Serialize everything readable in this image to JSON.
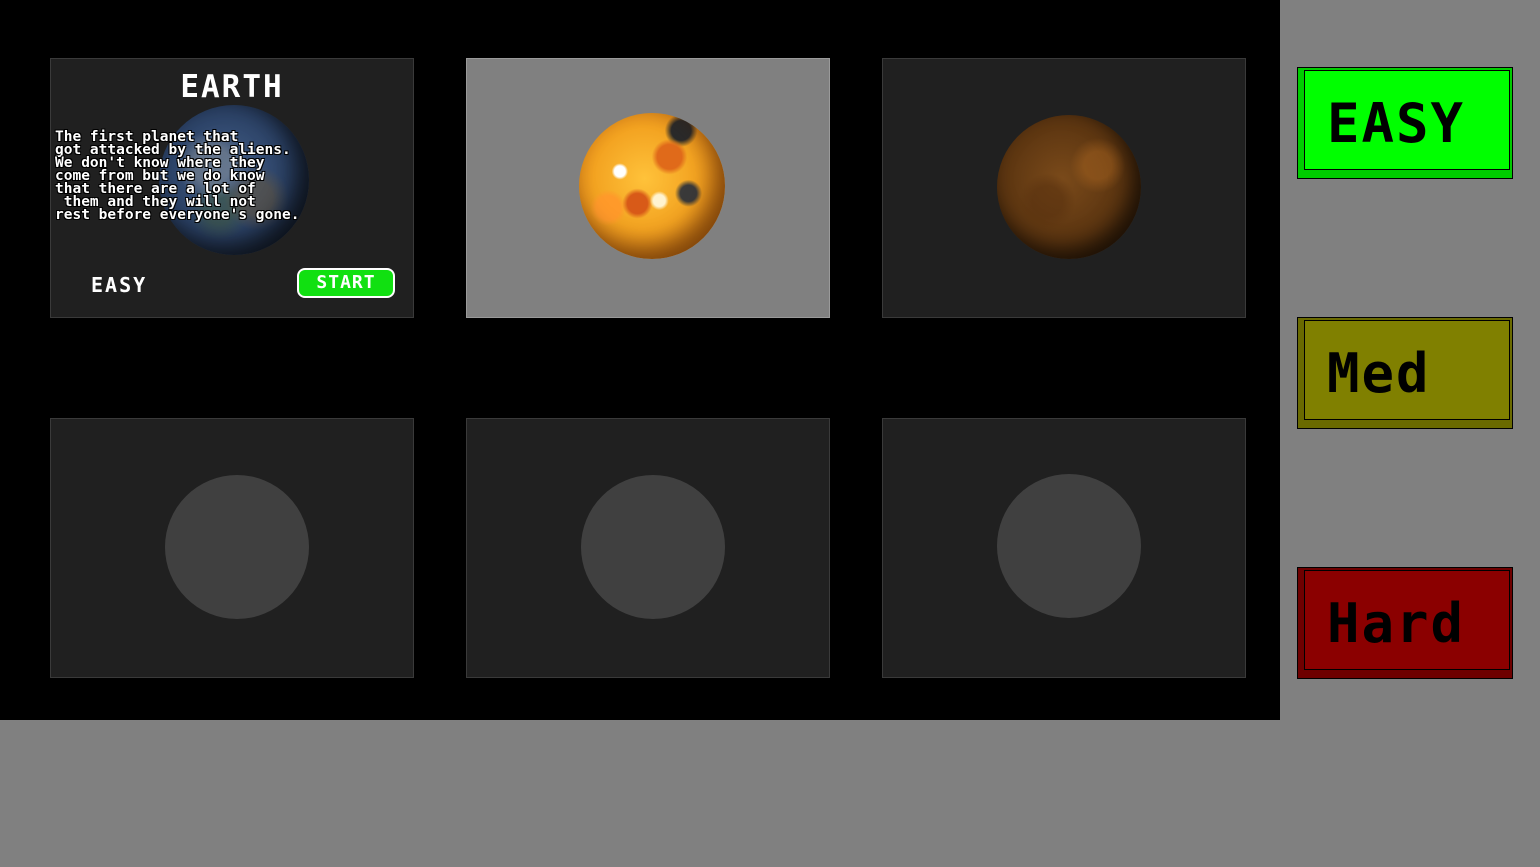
{
  "level_select": {
    "cards": [
      {
        "title": "EARTH",
        "description_lines": [
          "The first planet that",
          "got attacked by the aliens.",
          "We don't know where they",
          "come from but we do know",
          "that there are a lot of",
          " them and they will not",
          "rest before everyone's gone."
        ],
        "difficulty": "EASY",
        "start_label": "START",
        "planet": "earth-icon",
        "state": "info"
      },
      {
        "planet": "mars-icon",
        "state": "selected"
      },
      {
        "planet": "brown-planet-icon",
        "state": "unlocked"
      },
      {
        "planet": "locked-planet-icon",
        "state": "locked"
      },
      {
        "planet": "locked-planet-icon",
        "state": "locked"
      },
      {
        "planet": "locked-planet-icon",
        "state": "locked"
      }
    ]
  },
  "difficulty_panel": {
    "easy_label": "EASY",
    "med_label": "Med",
    "hard_label": "Hard",
    "selected": "EASY"
  },
  "colors": {
    "easy": "#00ff00",
    "med": "#808000",
    "hard": "#8b0000",
    "start": "#11e011",
    "background": "#808080",
    "stage": "#000000"
  }
}
